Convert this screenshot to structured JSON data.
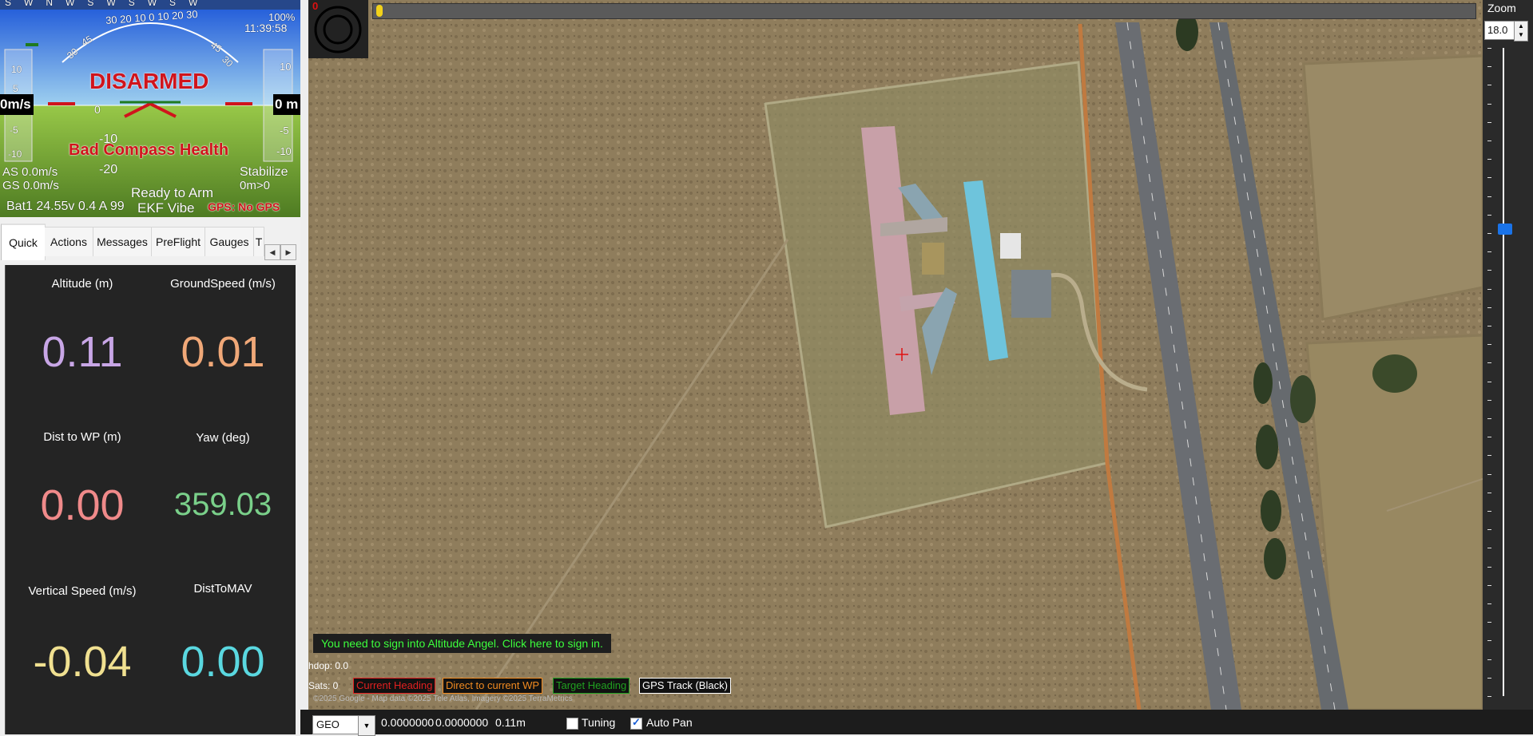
{
  "hud": {
    "heading_ticks": [
      "SW",
      "NW",
      "SW",
      "SW",
      "SW"
    ],
    "heading_scale": "30 20 10 0 10 20 30",
    "pitch_left": [
      "10",
      "5",
      "0",
      "-5",
      "-10"
    ],
    "pitch_center": [
      "0",
      "-10",
      "-20"
    ],
    "pitch_marks": [
      "30",
      "45",
      "45",
      "30"
    ],
    "battery_pct": "100%",
    "clock": "11:39:58",
    "speed_left": "0m/s",
    "speed_right": "0 m",
    "disarmed": "DISARMED",
    "compass_warning": "Bad Compass Health",
    "airspeed": "AS 0.0m/s",
    "groundspeed": "GS 0.0m/s",
    "mode": "Stabilize",
    "dist_home": "0m>0",
    "ready": "Ready to Arm",
    "battery": "Bat1 24.55v 0.4 A 99",
    "ekf": "EKF Vibe",
    "gps": "GPS: No GPS"
  },
  "tabs": {
    "items": [
      "Quick",
      "Actions",
      "Messages",
      "PreFlight",
      "Gauges",
      "T"
    ],
    "active": "Quick",
    "scroll_left": "◀",
    "scroll_right": "▶"
  },
  "quick": {
    "items": [
      {
        "label": "Altitude (m)",
        "value": "0.11",
        "color": "#c8a6e6"
      },
      {
        "label": "GroundSpeed (m/s)",
        "value": "0.01",
        "color": "#f0a878"
      },
      {
        "label": "Dist to WP (m)",
        "value": "0.00",
        "color": "#f08a8a"
      },
      {
        "label": "Yaw (deg)",
        "value": "359.03",
        "color": "#7ad08a"
      },
      {
        "label": "Vertical Speed (m/s)",
        "value": "-0.04",
        "color": "#f0e090"
      },
      {
        "label": "DistToMAV",
        "value": "0.00",
        "color": "#5ad8e0"
      }
    ]
  },
  "map": {
    "ring_label": "0",
    "altitude_angel": "You need to sign into Altitude Angel. Click here to sign in.",
    "hdop": "hdop: 0.0",
    "sats": "Sats: 0",
    "legend": [
      {
        "label": "Current Heading",
        "color": "#e02020"
      },
      {
        "label": "Direct to current WP",
        "color": "#f08a20"
      },
      {
        "label": "Target Heading",
        "color": "#20a020"
      },
      {
        "label": "GPS Track (Black)",
        "color": "#ffffff"
      }
    ],
    "copyright": "©2025 Google - Map data ©2025 Tele Atlas, Imagery ©2025 TerraMetrics"
  },
  "zoom": {
    "title": "Zoom",
    "value": "18.0",
    "up": "▲",
    "down": "▼",
    "level_pct": 72
  },
  "status": {
    "coord_system": "GEO",
    "dropdown": "▼",
    "lat": "0.0000000",
    "lng": "0.0000000",
    "alt": "0.11m",
    "tuning": "Tuning",
    "tuning_checked": false,
    "autopan": "Auto Pan",
    "autopan_checked": true
  }
}
